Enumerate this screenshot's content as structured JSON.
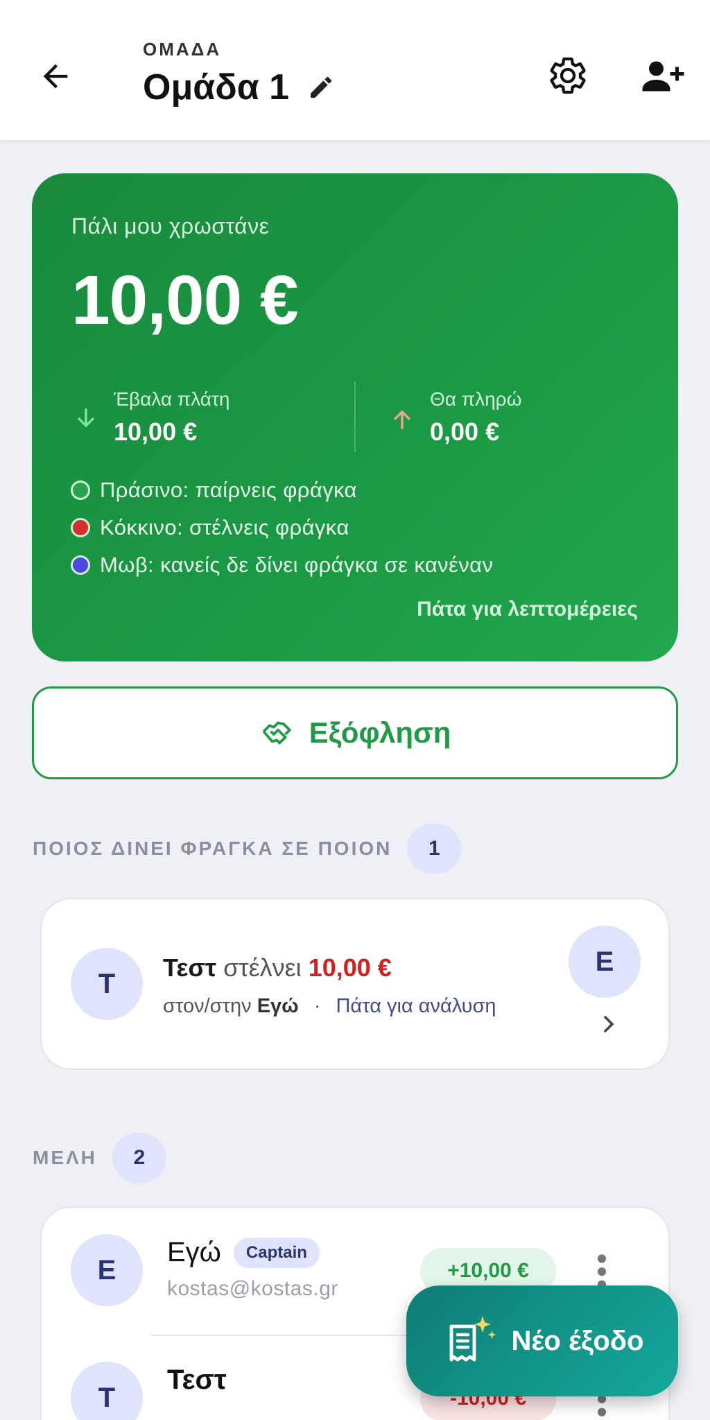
{
  "header": {
    "overline": "ΟΜΑΔΑ",
    "title": "Ομάδα 1"
  },
  "balance": {
    "label": "Πάλι μου χρωστάνε",
    "amount": "10,00 €",
    "paid_label": "Έβαλα πλάτη",
    "paid_value": "10,00 €",
    "owe_label": "Θα πληρώ",
    "owe_value": "0,00 €",
    "legend": [
      {
        "text": "Πράσινο: παίρνεις φράγκα",
        "color": "#2aa24f"
      },
      {
        "text": "Κόκκινο: στέλνεις φράγκα",
        "color": "#d32f2f"
      },
      {
        "text": "Μωβ: κανείς δε δίνει φράγκα σε κανέναν",
        "color": "#4b4ae0"
      }
    ],
    "details_link": "Πάτα για λεπτομέρειες",
    "card_color": "#1b9a44"
  },
  "settle_button": {
    "label": "Εξόφληση"
  },
  "debts_section": {
    "title": "ΠΟΙΟΣ ΔΙΝΕΙ ΦΡΑΓΚΑ ΣΕ ΠΟΙΟΝ",
    "count": "1",
    "items": [
      {
        "from_initial": "Τ",
        "from_name": "Τεστ",
        "verb": "στέλνει",
        "amount": "10,00 €",
        "to_prefix": "στον/στην",
        "to_name": "Εγώ",
        "separator": "·",
        "analysis_link": "Πάτα για ανάλυση",
        "to_initial": "Ε"
      }
    ]
  },
  "members_section": {
    "title": "ΜΕΛΗ",
    "count": "2",
    "members": [
      {
        "initial": "Ε",
        "name": "Εγώ",
        "badge": "Captain",
        "email": "kostas@kostas.gr",
        "balance": "+10,00 €"
      },
      {
        "initial": "Τ",
        "name": "Τεστ",
        "badge": "",
        "email": "",
        "balance": "-10,00 €"
      }
    ]
  },
  "fab": {
    "label": "Νέο έξοδο"
  }
}
